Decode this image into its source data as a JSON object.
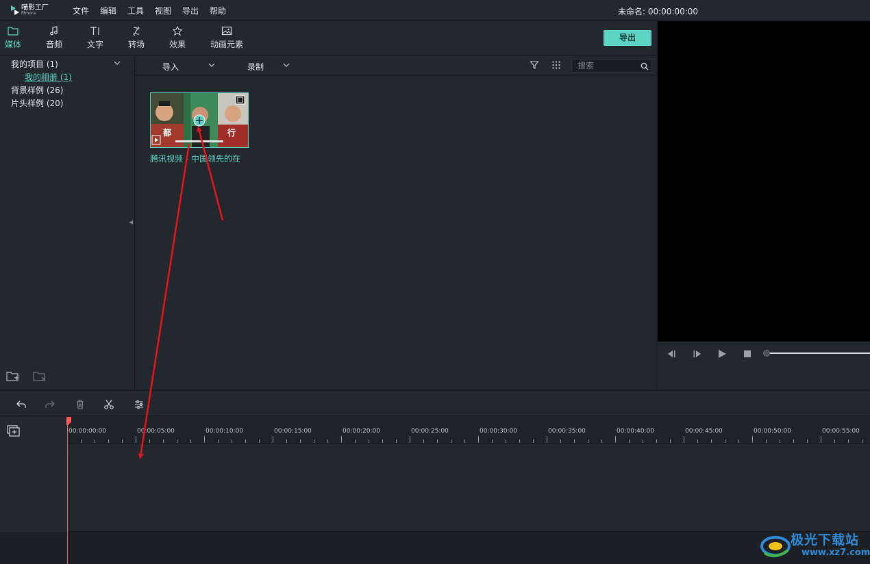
{
  "app": {
    "logo_text": "喵影工厂",
    "logo_sub": "filmora",
    "doc_title": "未命名: 00:00:00:00"
  },
  "menu": [
    "文件",
    "编辑",
    "工具",
    "视图",
    "导出",
    "帮助"
  ],
  "tools": [
    {
      "label": "媒体",
      "icon": "folder-icon",
      "active": true
    },
    {
      "label": "音频",
      "icon": "music-note-icon"
    },
    {
      "label": "文字",
      "icon": "text-icon"
    },
    {
      "label": "转场",
      "icon": "transition-icon"
    },
    {
      "label": "效果",
      "icon": "effects-icon"
    },
    {
      "label": "动画元素",
      "icon": "image-icon"
    }
  ],
  "export_label": "导出",
  "sidebar": {
    "items": [
      {
        "label": "我的项目 (1)"
      },
      {
        "label": "我的相册 (1)",
        "sub": true
      },
      {
        "label": "背景样例 (26)"
      },
      {
        "label": "片头样例 (20)"
      }
    ]
  },
  "media_bar": {
    "import_label": "导入",
    "record_label": "录制",
    "search_placeholder": "搜索"
  },
  "media": {
    "clip_name": "腾讯视频 - 中国领先的在",
    "frame_texts": [
      "都",
      "行"
    ]
  },
  "timeline": {
    "ticks": [
      "00:00:00:00",
      "00:00:05:00",
      "00:00:10:00",
      "00:00:15:00",
      "00:00:20:00",
      "00:00:25:00",
      "00:00:30:00",
      "00:00:35:00",
      "00:00:40:00",
      "00:00:45:00",
      "00:00:50:00",
      "00:00:55:00"
    ]
  },
  "watermark": {
    "text": "极光下载站",
    "url": "www.xz7.com"
  },
  "colors": {
    "accent": "#5dd0c3",
    "playhead": "#ff5a5a",
    "annotation": "#e8141a"
  }
}
